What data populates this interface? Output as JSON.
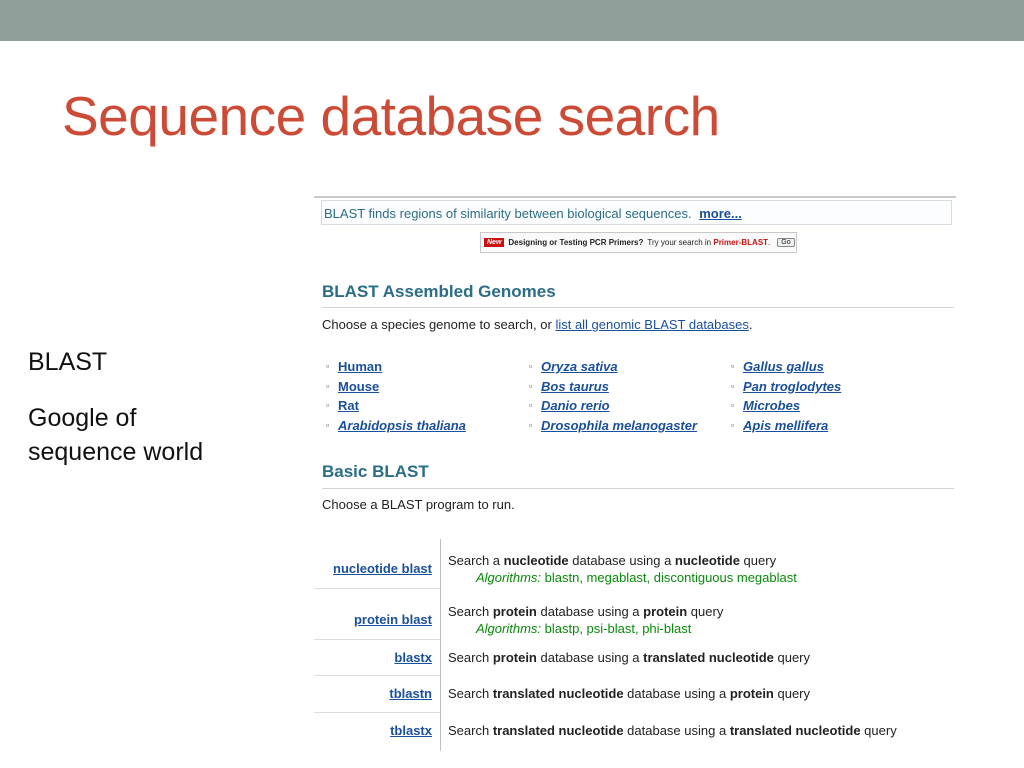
{
  "slide": {
    "title": "Sequence database search",
    "bullets": [
      "BLAST",
      "Google of sequence world"
    ]
  },
  "blast": {
    "intro": "BLAST finds regions of similarity between biological sequences.",
    "more_link": "more...",
    "promo": {
      "new_badge": "New",
      "question": "Designing or Testing PCR Primers?",
      "text": "Try your search in",
      "link": "Primer-BLAST",
      "dot": ".",
      "go_button": "Go"
    },
    "genomes": {
      "title": "BLAST Assembled Genomes",
      "prompt": "Choose a species genome to search, or",
      "prompt_link": "list all genomic BLAST databases",
      "prompt_end": ".",
      "columns": [
        [
          {
            "label": "Human",
            "italic": false
          },
          {
            "label": "Mouse",
            "italic": false
          },
          {
            "label": "Rat",
            "italic": false
          },
          {
            "label": "Arabidopsis thaliana",
            "italic": true
          }
        ],
        [
          {
            "label": "Oryza sativa",
            "italic": true
          },
          {
            "label": "Bos taurus",
            "italic": true
          },
          {
            "label": "Danio rerio",
            "italic": true
          },
          {
            "label": "Drosophila melanogaster",
            "italic": true
          }
        ],
        [
          {
            "label": "Gallus gallus",
            "italic": true
          },
          {
            "label": "Pan troglodytes",
            "italic": true
          },
          {
            "label": "Microbes",
            "italic": true
          },
          {
            "label": "Apis mellifera",
            "italic": true
          }
        ]
      ]
    },
    "basic": {
      "title": "Basic BLAST",
      "prompt": "Choose a BLAST program to run.",
      "programs": [
        {
          "name": "nucleotide blast",
          "desc": [
            "Search a ",
            "nucleotide",
            " database using a ",
            "nucleotide",
            " query"
          ],
          "alg_label": "Algorithms:",
          "alg_text": "blastn, megablast, discontiguous megablast"
        },
        {
          "name": "protein blast",
          "desc": [
            "Search ",
            "protein",
            " database using a ",
            "protein",
            " query"
          ],
          "alg_label": "Algorithms:",
          "alg_text": "blastp, psi-blast, phi-blast"
        },
        {
          "name": "blastx",
          "desc": [
            "Search ",
            "protein",
            " database using a ",
            "translated nucleotide",
            " query"
          ]
        },
        {
          "name": "tblastn",
          "desc": [
            "Search ",
            "translated nucleotide",
            " database using a ",
            "protein",
            " query"
          ]
        },
        {
          "name": "tblastx",
          "desc": [
            "Search ",
            "translated nucleotide",
            " database using a ",
            "translated nucleotide",
            " query"
          ]
        }
      ]
    }
  }
}
